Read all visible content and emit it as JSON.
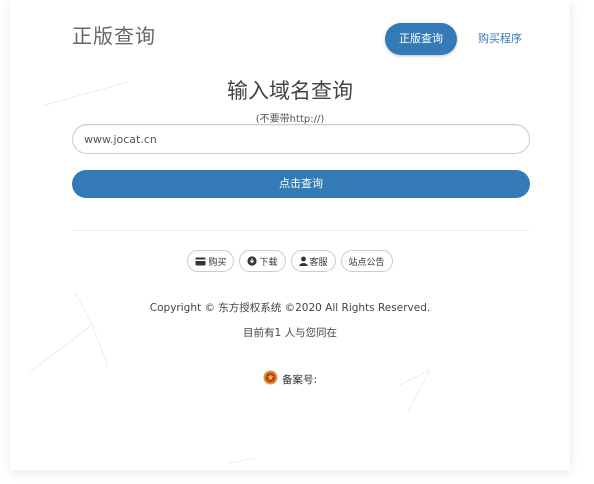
{
  "header": {
    "brand": "正版查询",
    "nav_active_label": "正版查询",
    "nav_buy_label": "购买程序"
  },
  "main": {
    "title": "输入域名查询",
    "subtitle": "(不要带http://)",
    "domain_value": "www.jocat.cn",
    "query_button_label": "点击查询"
  },
  "footer_links": [
    {
      "icon": "card-icon",
      "label": "购买"
    },
    {
      "icon": "download-icon",
      "label": "下载"
    },
    {
      "icon": "user-icon",
      "label": "客服"
    },
    {
      "icon": "",
      "label": "站点公告"
    }
  ],
  "footer": {
    "copyright": "Copyright © 东方授权系统  ©2020 All Rights Reserved.",
    "online": "目前有1 人与您同在",
    "beian_label": "备案号:"
  },
  "colors": {
    "primary": "#337ab7",
    "text": "#333333",
    "muted": "#666666"
  }
}
